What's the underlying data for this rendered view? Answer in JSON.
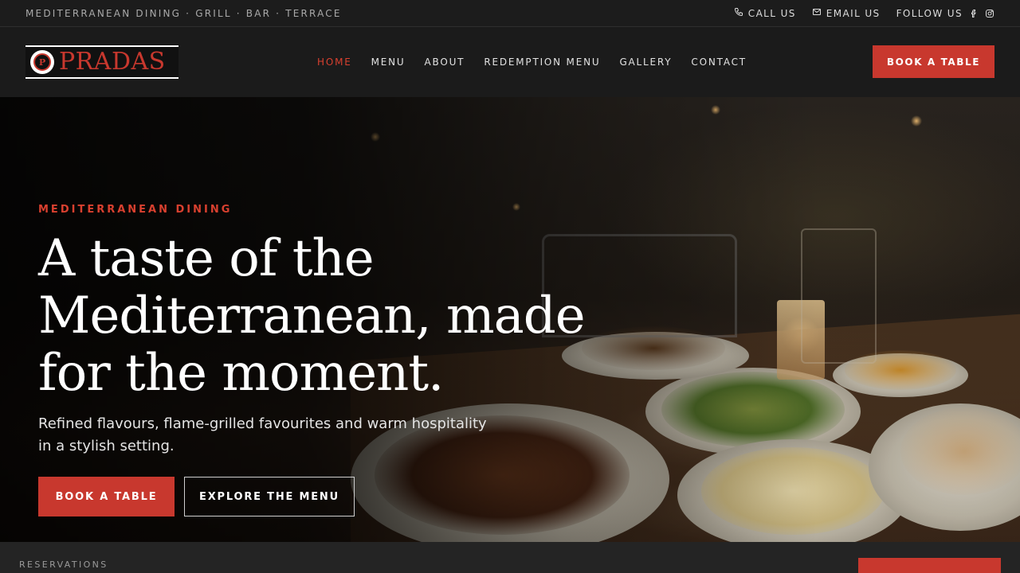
{
  "topbar": {
    "tagline": "MEDITERRANEAN DINING · GRILL · BAR · TERRACE",
    "call_label": "CALL US",
    "email_label": "EMAIL US",
    "follow_label": "FOLLOW US",
    "icons": [
      "phone-icon",
      "mail-icon",
      "facebook-icon",
      "instagram-icon"
    ]
  },
  "header": {
    "logo_text": "PRADAS",
    "logo_emblem": "P",
    "nav": [
      {
        "label": "HOME",
        "active": true
      },
      {
        "label": "MENU",
        "active": false
      },
      {
        "label": "ABOUT",
        "active": false
      },
      {
        "label": "REDEMPTION MENU",
        "active": false
      },
      {
        "label": "GALLERY",
        "active": false
      },
      {
        "label": "CONTACT",
        "active": false
      }
    ],
    "cta_label": "BOOK A TABLE"
  },
  "hero": {
    "eyebrow": "MEDITERRANEAN DINING",
    "headline_line1": "A taste of the",
    "headline_line2": "Mediterranean, made",
    "headline_line3": "for the moment.",
    "subtext_line1": "Refined flavours, flame-grilled favourites and warm hospitality",
    "subtext_line2": "in a stylish setting.",
    "primary_button": "BOOK A TABLE",
    "secondary_button": "EXPLORE THE MENU"
  },
  "reservations": {
    "label": "RESERVATIONS"
  },
  "colors": {
    "accent": "#c8382e",
    "accent_text": "#d9402f",
    "background": "#1b1b1b"
  }
}
